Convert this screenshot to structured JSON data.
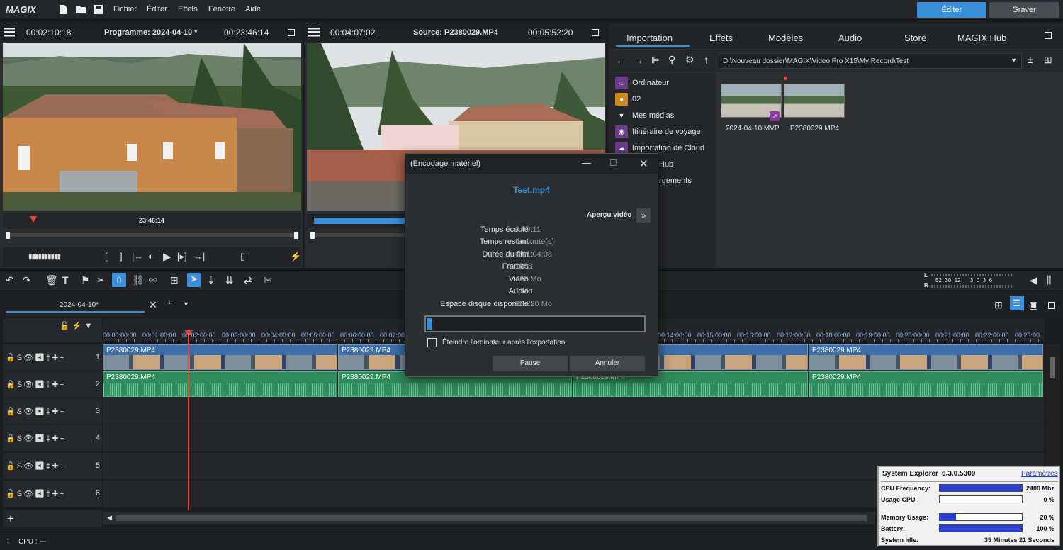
{
  "app": {
    "logo": "MAGIX"
  },
  "menu": [
    "Fichier",
    "Éditer",
    "Effets",
    "Fenêtre",
    "Aide"
  ],
  "topbuttons": {
    "edit": "Éditer",
    "burn": "Graver"
  },
  "program_monitor": {
    "timecode_left": "00:02:10:18",
    "title": "Programme: 2024-04-10 *",
    "timecode_right": "00:23:46:14",
    "scrub_time": "23:46:14"
  },
  "source_monitor": {
    "timecode_left": "00:04:07:02",
    "title": "Source: P2380029.MP4",
    "timecode_right": "00:05:52:20"
  },
  "media_tabs": [
    "Importation",
    "Effets",
    "Modèles",
    "Audio",
    "Store",
    "MAGIX Hub"
  ],
  "path": "D:\\Nouveau dossier\\MAGIX\\Video Pro X15\\My Record\\Test",
  "tree": [
    "Ordinateur",
    "02",
    "Mes médias",
    "Itinéraire de voyage",
    "Importation de Cloud",
    "Hub",
    "rgements"
  ],
  "files": [
    "2024-04-10.MVP",
    "P2380029.MP4"
  ],
  "timeline": {
    "tab": "2024-04-10*",
    "ruler": [
      "00:00:00:00",
      "00:01:00:00",
      "00:02:00:00",
      "00:03:00:00",
      "00:04:00:00",
      "00:05:00:00",
      "00:06:00:00",
      "00:07:00",
      "00:14:00:00",
      "00:15:00:00",
      "00:16:00:00",
      "00:17:00:00",
      "00:18:00:00",
      "00:19:00:00",
      "00:20:00:00",
      "00:21:00:00",
      "00:22:00:00",
      "00:23:00"
    ],
    "clip_name": "P2380029.MP4",
    "tracks": [
      "1",
      "2",
      "3",
      "4",
      "5",
      "6"
    ],
    "meter_labels": {
      "l": "L",
      "r": "R",
      "scale": "52  30  12      3  0  3  6"
    }
  },
  "status": {
    "cpu": "CPU : ---"
  },
  "dialog": {
    "title": "(Encodage matériel)",
    "filename": "Test.mp4",
    "preview_label": "Aperçu vidéo",
    "rows": [
      {
        "label": "Temps écoulé :",
        "value": "0:00:11"
      },
      {
        "label": "Temps restant :",
        "value": "4 minute(s)"
      },
      {
        "label": "Durée du film :",
        "value": "0:01:04:08"
      },
      {
        "label": "Frames :",
        "value": "1608"
      },
      {
        "label": "Vidéo :",
        "value": "465 Mo"
      },
      {
        "label": "Audio :",
        "value": "1 Mo"
      },
      {
        "label": "Espace disque disponible :",
        "value": "86.220 Mo"
      }
    ],
    "progress": 0.01,
    "checkbox_label": "Éteindre l'ordinateur après l'exportation",
    "pause": "Pause",
    "cancel": "Annuler"
  },
  "system_explorer": {
    "title": "System Explorer",
    "version": "6.3.0.5309",
    "link": "Paramètres",
    "cpu_freq_label": "CPU Frequency:",
    "cpu_freq_value": "2400 Mhz",
    "cpu_freq_fill": 1.0,
    "cpu_usage_label": "Usage CPU :",
    "cpu_usage_value": "0 %",
    "cpu_usage_fill": 0.0,
    "mem_label": "Memory Usage:",
    "mem_value": "20 %",
    "mem_fill": 0.2,
    "battery_label": "Battery:",
    "battery_value": "100 %",
    "battery_fill": 1.0,
    "idle_label": "System Idle:",
    "idle_value": "35 Minutes 21 Seconds"
  },
  "colors": {
    "accent": "#3b8fd8",
    "video_clip": "#3d6ea8",
    "audio_clip": "#2f8c5c",
    "playhead": "#e8453c"
  }
}
